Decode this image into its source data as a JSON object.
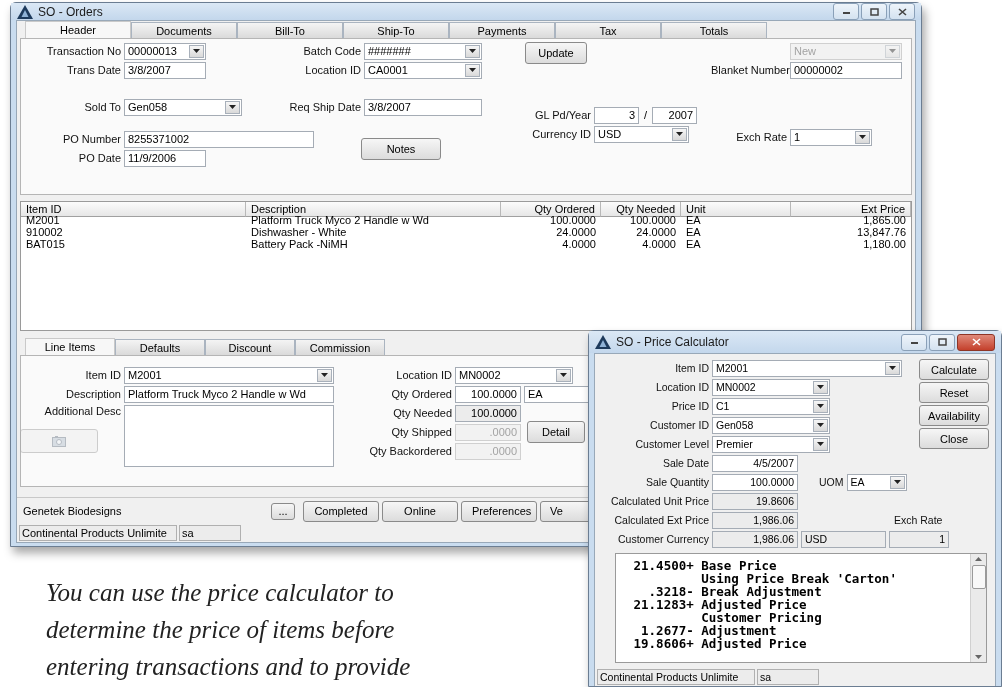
{
  "main_window": {
    "title": "SO - Orders",
    "tabs": [
      {
        "label": "Header",
        "selected": true
      },
      {
        "label": "Documents",
        "selected": false
      },
      {
        "label": "Bill-To",
        "selected": false
      },
      {
        "label": "Ship-To",
        "selected": false
      },
      {
        "label": "Payments",
        "selected": false
      },
      {
        "label": "Tax",
        "selected": false
      },
      {
        "label": "Totals",
        "selected": false
      }
    ],
    "header": {
      "transaction_no": {
        "label": "Transaction No",
        "value": "00000013"
      },
      "trans_date": {
        "label": "Trans Date",
        "value": "3/8/2007"
      },
      "sold_to": {
        "label": "Sold To",
        "value": "Gen058"
      },
      "po_number": {
        "label": "PO Number",
        "value": "8255371002"
      },
      "po_date": {
        "label": "PO Date",
        "value": "11/9/2006"
      },
      "batch_code": {
        "label": "Batch Code",
        "value": "#######"
      },
      "location_id": {
        "label": "Location ID",
        "value": "CA0001"
      },
      "req_ship_date": {
        "label": "Req Ship Date",
        "value": "3/8/2007"
      },
      "notes_button": "Notes",
      "update_button": "Update",
      "gl_period": {
        "label": "GL Pd/Year",
        "period": "3",
        "separator": "/",
        "year": "2007"
      },
      "currency_id": {
        "label": "Currency ID",
        "value": "USD"
      },
      "status": {
        "value": "New",
        "disabled": true
      },
      "blanket_number": {
        "label": "Blanket Number",
        "value": "00000002"
      },
      "exch_rate": {
        "label": "Exch Rate",
        "value": "1"
      }
    },
    "lines_table": {
      "columns": [
        "Item ID",
        "Description",
        "Qty Ordered",
        "Qty Needed",
        "Unit",
        "Ext Price"
      ],
      "rows": [
        [
          "M2001",
          "Platform Truck Myco 2 Handle w Wd",
          "100.0000",
          "100.0000",
          "EA",
          "1,865.00"
        ],
        [
          "910002",
          "Dishwasher - White",
          "24.0000",
          "24.0000",
          "EA",
          "13,847.76"
        ],
        [
          "BAT015",
          "Battery Pack -NiMH",
          "4.0000",
          "4.0000",
          "EA",
          "1,180.00"
        ]
      ]
    },
    "line_tabs": [
      {
        "label": "Line Items",
        "selected": true
      },
      {
        "label": "Defaults",
        "selected": false
      },
      {
        "label": "Discount",
        "selected": false
      },
      {
        "label": "Commission",
        "selected": false
      }
    ],
    "line_item": {
      "item_id": {
        "label": "Item ID",
        "value": "M2001"
      },
      "description": {
        "label": "Description",
        "value": "Platform Truck Myco 2 Handle w Wd"
      },
      "additional_desc": {
        "label": "Additional Desc"
      },
      "attach_button": {
        "disabled": true
      },
      "location_id": {
        "label": "Location ID",
        "value": "MN0002"
      },
      "qty_ordered": {
        "label": "Qty Ordered",
        "value": "100.0000",
        "unit": "EA"
      },
      "qty_needed": {
        "label": "Qty Needed",
        "value": "100.0000",
        "readonly": true
      },
      "qty_shipped": {
        "label": "Qty Shipped",
        "value": ".0000",
        "disabled": true
      },
      "qty_backordered": {
        "label": "Qty Backordered",
        "value": ".0000",
        "disabled": true
      },
      "detail_button": "Detail"
    },
    "company": "Genetek Biodesigns",
    "buttons": [
      "...",
      "Completed",
      "Online",
      "Preferences",
      "Ve"
    ],
    "status_bar": [
      "Continental Products Unlimite",
      "sa"
    ]
  },
  "calculator": {
    "title": "SO - Price Calculator",
    "item_id": {
      "label": "Item ID",
      "value": "M2001"
    },
    "location_id": {
      "label": "Location ID",
      "value": "MN0002"
    },
    "price_id": {
      "label": "Price ID",
      "value": "C1"
    },
    "customer_id": {
      "label": "Customer ID",
      "value": "Gen058"
    },
    "customer_level": {
      "label": "Customer Level",
      "value": "Premier"
    },
    "sale_date": {
      "label": "Sale Date",
      "value": "4/5/2007"
    },
    "sale_quantity": {
      "label": "Sale Quantity",
      "value": "100.0000"
    },
    "uom": {
      "label": "UOM",
      "value": "EA"
    },
    "unit_price": {
      "label": "Calculated Unit Price",
      "value": "19.8606",
      "readonly": true
    },
    "ext_price": {
      "label": "Calculated Ext Price",
      "value": "1,986.06",
      "readonly": true
    },
    "customer_currency": {
      "label": "Customer Currency",
      "value": "1,986.06",
      "currency": "USD",
      "readonly": true
    },
    "exch_rate": {
      "label": "Exch Rate",
      "value": "1",
      "readonly": true
    },
    "buttons": [
      "Calculate",
      "Reset",
      "Availability",
      "Close"
    ],
    "log": [
      {
        "amount": "21.4500+",
        "text": "Base Price"
      },
      {
        "text": "Using Price Break 'Carton'"
      },
      {
        "amount": ".3218-",
        "text": "Break Adjustment"
      },
      {
        "amount": "21.1283+",
        "text": "Adjusted Price"
      },
      {
        "text": "Customer Pricing"
      },
      {
        "amount": "1.2677-",
        "text": "Adjustment"
      },
      {
        "amount": "19.8606+",
        "text": "Adjusted Price"
      }
    ],
    "status_bar": [
      "Continental Products Unlimite",
      "sa"
    ]
  },
  "caption": {
    "lines": [
      "You can use the price calculator to",
      "determine the price of items before",
      "entering transactions and to provide"
    ]
  }
}
